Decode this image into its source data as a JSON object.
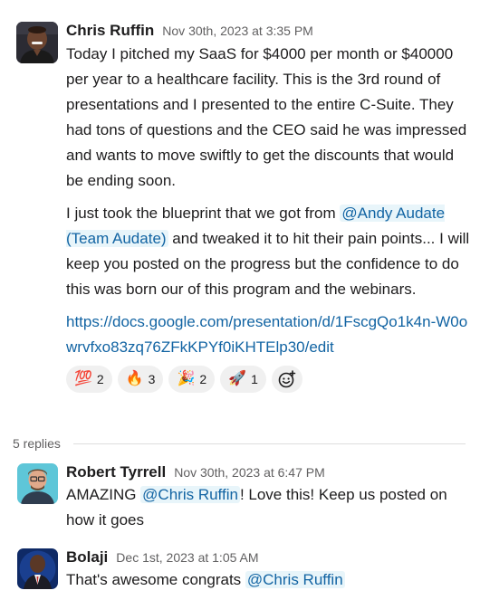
{
  "main_message": {
    "author": "Chris Ruffin",
    "timestamp": "Nov 30th, 2023 at 3:35 PM",
    "paragraph1": "Today I pitched my SaaS for $4000 per month or $40000 per year to a healthcare facility. This is the 3rd round of presentations and I presented to the entire C-Suite. They had tons of questions and the CEO said he was impressed and wants to move swiftly to get the discounts that would be ending soon.",
    "paragraph2_before": "I just took the blueprint that we got from ",
    "paragraph2_mention": "@Andy Audate (Team Audate)",
    "paragraph2_after": " and tweaked it to hit their pain points... I will keep you posted on the progress but the confidence to do this was born our of this program and the webinars.",
    "link": "https://docs.google.com/presentation/d/1FscgQo1k4n-W0owrvfxo83zq76ZFkKPYf0iKHTElp30/edit",
    "reactions": [
      {
        "emoji": "💯",
        "icon": "hundred-points-emoji",
        "count": "2"
      },
      {
        "emoji": "🔥",
        "icon": "fire-emoji",
        "count": "3"
      },
      {
        "emoji": "🎉",
        "icon": "party-popper-emoji",
        "count": "2"
      },
      {
        "emoji": "🚀",
        "icon": "rocket-emoji",
        "count": "1"
      }
    ]
  },
  "replies_label": "5 replies",
  "replies": [
    {
      "author": "Robert Tyrrell",
      "timestamp": "Nov 30th, 2023 at 6:47 PM",
      "text_before": "AMAZING ",
      "mention": "@Chris Ruffin",
      "text_after": "! Love this! Keep us posted on how it goes"
    },
    {
      "author": "Bolaji",
      "timestamp": "Dec 1st, 2023 at 1:05 AM",
      "text_before": "That's awesome congrats ",
      "mention": "@Chris Ruffin",
      "text_after": ""
    }
  ],
  "colors": {
    "link": "#1264a3",
    "mention_bg": "#e8f5fa",
    "reaction_bg": "#f0f0f0",
    "muted": "#616061"
  }
}
